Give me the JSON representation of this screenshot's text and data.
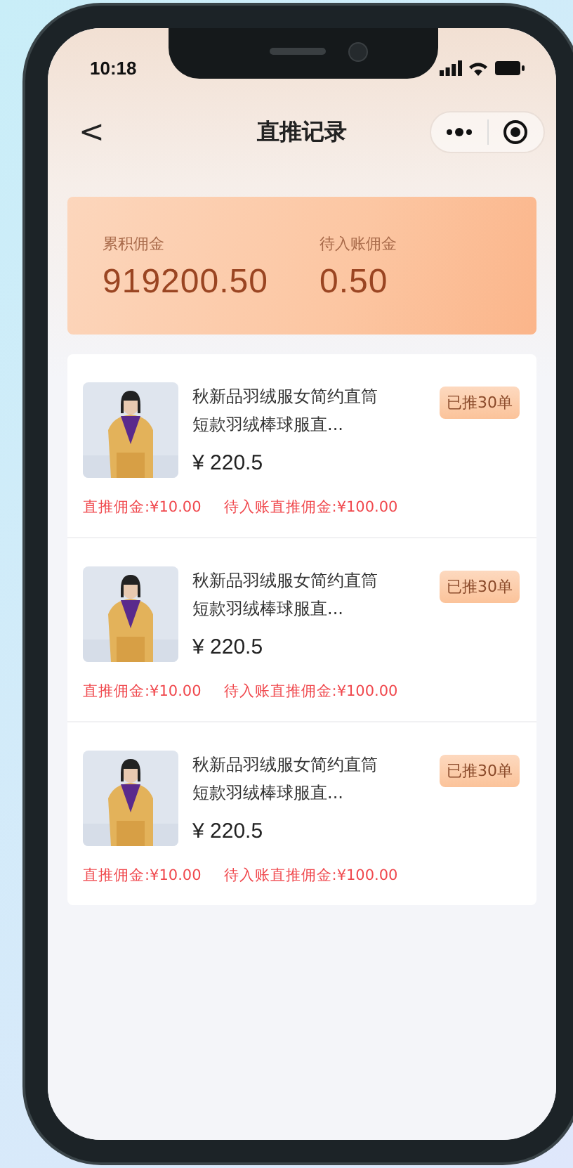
{
  "status_bar": {
    "time": "10:18"
  },
  "nav": {
    "back": "<",
    "title": "直推记录"
  },
  "summary": [
    {
      "label": "累积佣金",
      "value": "919200.50"
    },
    {
      "label": "待入账佣金",
      "value": "0.50"
    }
  ],
  "items": [
    {
      "title": "秋新品羽绒服女简约直筒短款羽绒棒球服直...",
      "price": "¥ 220.5",
      "badge": "已推30单",
      "commission": "直推佣金:¥10.00",
      "pending": "待入账直推佣金:¥100.00"
    },
    {
      "title": "秋新品羽绒服女简约直筒短款羽绒棒球服直...",
      "price": "¥ 220.5",
      "badge": "已推30单",
      "commission": "直推佣金:¥10.00",
      "pending": "待入账直推佣金:¥100.00"
    },
    {
      "title": "秋新品羽绒服女简约直筒短款羽绒棒球服直...",
      "price": "¥ 220.5",
      "badge": "已推30单",
      "commission": "直推佣金:¥10.00",
      "pending": "待入账直推佣金:¥100.00"
    }
  ]
}
